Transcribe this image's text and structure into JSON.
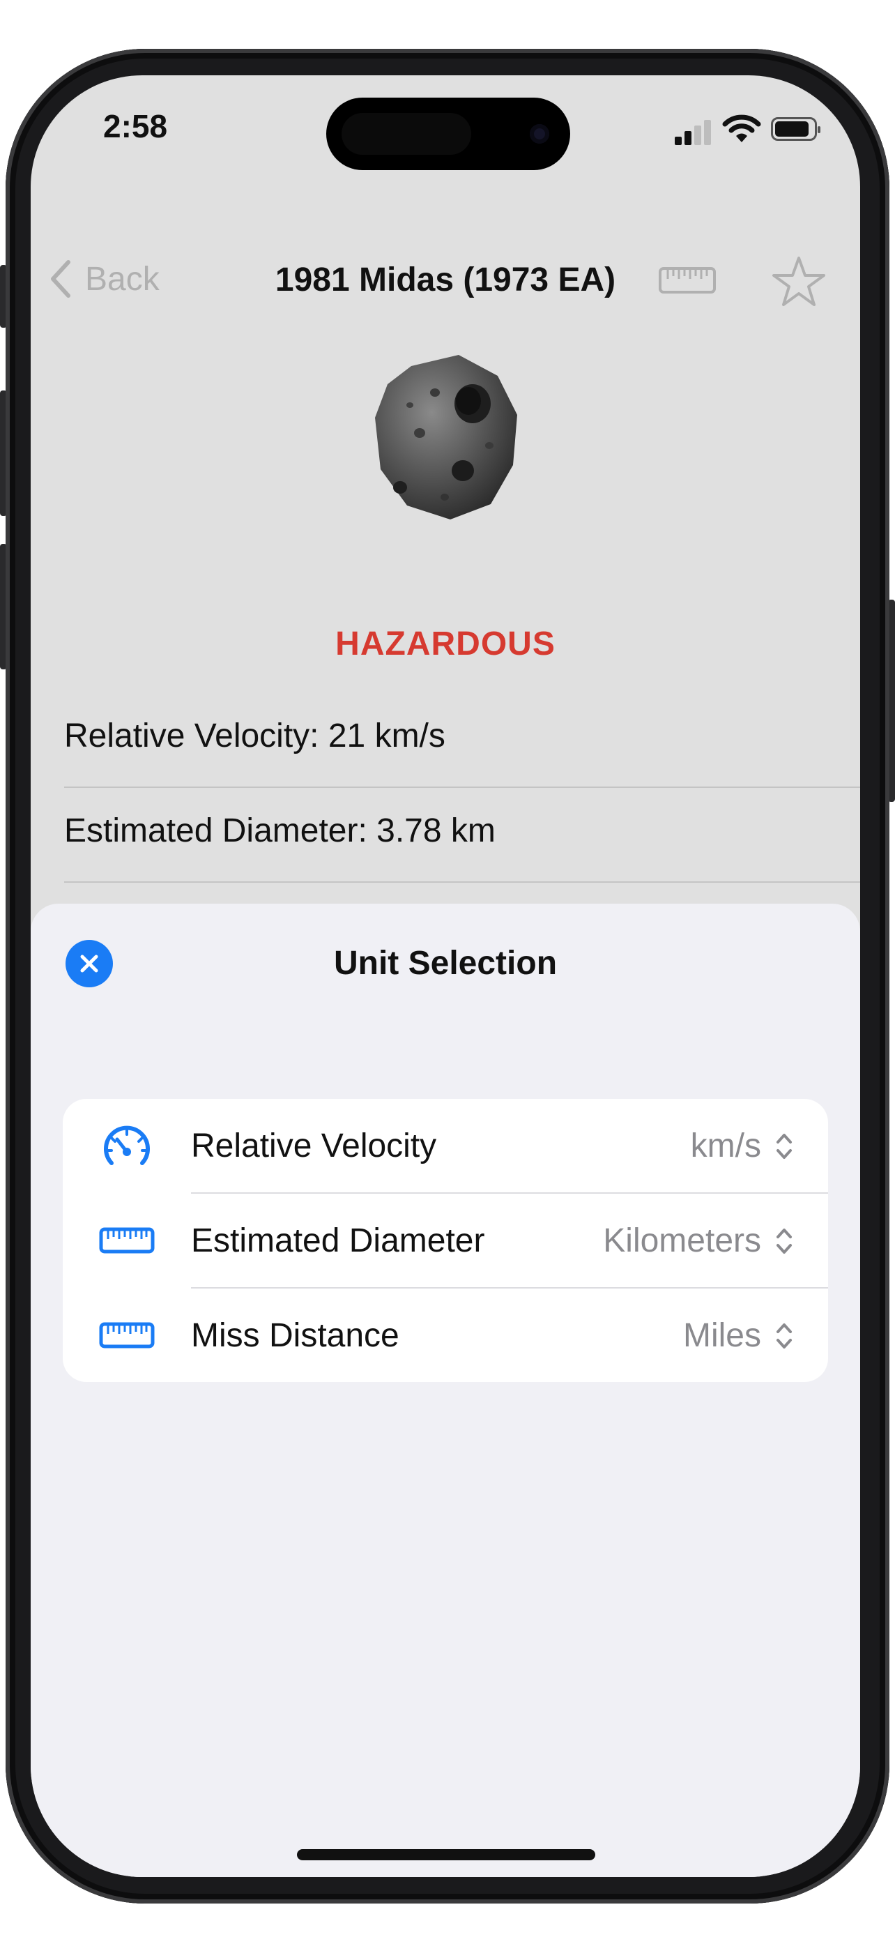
{
  "status_bar": {
    "time": "2:58"
  },
  "nav": {
    "back_label": "Back",
    "title": "1981 Midas (1973 EA)",
    "units_icon": "ruler-icon",
    "favorite_icon": "star-icon"
  },
  "detail": {
    "hazard_label": "HAZARDOUS",
    "velocity_text": "Relative Velocity: 21 km/s",
    "diameter_text": "Estimated Diameter:  3.78 km"
  },
  "sheet": {
    "title": "Unit Selection",
    "close_icon": "close-icon",
    "rows": [
      {
        "icon": "speedometer-icon",
        "label": "Relative Velocity",
        "value": "km/s"
      },
      {
        "icon": "ruler-icon",
        "label": "Estimated Diameter",
        "value": "Kilometers"
      },
      {
        "icon": "ruler-icon",
        "label": "Miss Distance",
        "value": "Miles"
      }
    ]
  },
  "colors": {
    "accent": "#1a7cf5",
    "hazard": "#d63a30",
    "dimmed_background": "#e0e0e0",
    "sheet_background": "#f0f0f5"
  }
}
